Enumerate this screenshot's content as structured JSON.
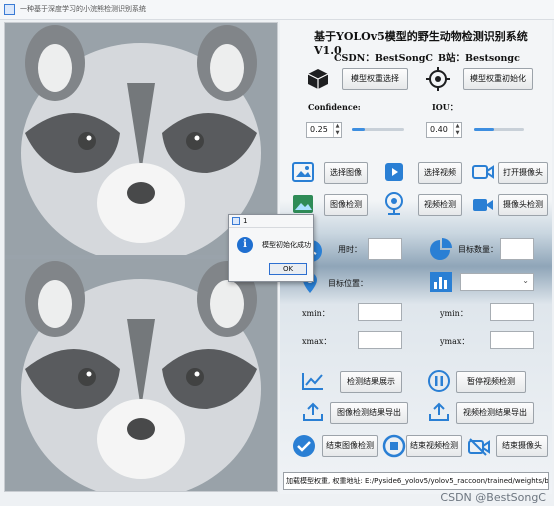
{
  "window": {
    "title": "一种基于深度学习的小浣熊检测识别系统"
  },
  "header": {
    "title": "基于YOLOv5模型的野生动物检测识别系统V1.0",
    "csdn_label": "CSDN：BestSongC",
    "bstation_label": "B站：Bestsongc"
  },
  "model": {
    "select_label": "模型权重选择",
    "init_label": "模型权重初始化"
  },
  "thresholds": {
    "confidence_label": "Confidence:",
    "confidence_value": "0.25",
    "confidence_fraction": 0.25,
    "iou_label": "IOU：",
    "iou_value": "0.40",
    "iou_fraction": 0.4
  },
  "buttons": {
    "select_image": "选择图像",
    "select_video": "选择视频",
    "open_camera": "打开摄像头",
    "image_detect": "图像检测",
    "video_detect": "视频检测",
    "camera_detect": "摄像头检测",
    "result_show": "检测结果展示",
    "pause_video": "暂停视频检测",
    "export_image": "图像检测结果导出",
    "export_video": "视频检测结果导出",
    "end_image": "结束图像检测",
    "end_video": "结束视频检测",
    "end_camera": "结束摄像头"
  },
  "results": {
    "time_label": "用时：",
    "count_label": "目标数量：",
    "position_label": "目标位置：",
    "xmin_label": "xmin：",
    "ymin_label": "ymin：",
    "xmax_label": "xmax：",
    "ymax_label": "ymax："
  },
  "status": {
    "text": "加载模型权重, 权重地址: E:/Pyside6_yolov5/yolov5_raccoon/trained/weights/best.pt"
  },
  "dialog": {
    "title": "1",
    "message": "模型初始化成功",
    "ok_label": "OK"
  },
  "watermark": "CSDN @BestSongC",
  "icons": [
    "app-icon",
    "cube-icon",
    "target-icon",
    "image-icon",
    "video-play-icon",
    "camera-icon",
    "image-detect-icon",
    "webcam-icon",
    "video-camera-icon",
    "clock-icon",
    "pie-chart-icon",
    "location-pin-icon",
    "bar-chart-icon",
    "chart-line-icon",
    "pause-icon",
    "export-icon",
    "check-circle-icon",
    "stop-icon",
    "camera-off-icon",
    "info-icon"
  ],
  "colors": {
    "accent": "#2a7fd4",
    "panel": "#eef1f4"
  }
}
